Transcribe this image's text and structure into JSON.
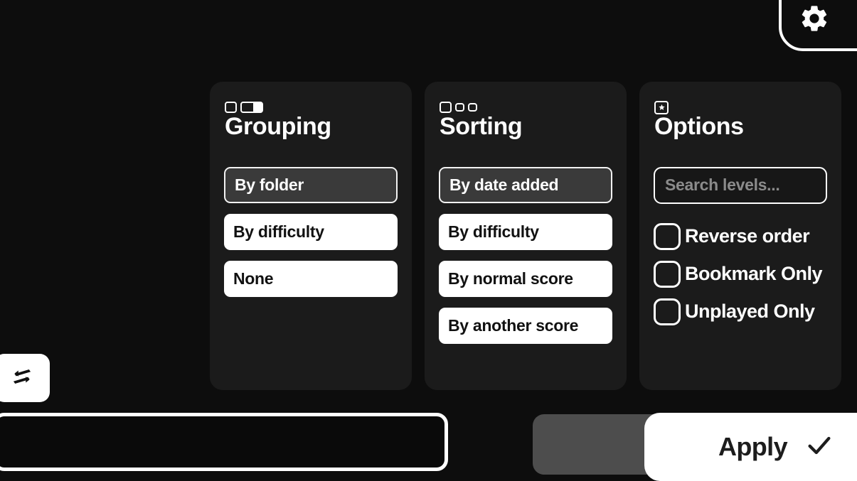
{
  "topbar": {
    "settings_icon": "gear-icon"
  },
  "cards": [
    {
      "key": "grouping",
      "title": "Grouping",
      "icon": "grouping-icon",
      "options": [
        {
          "label": "By folder",
          "selected": true
        },
        {
          "label": "By difficulty",
          "selected": false
        },
        {
          "label": "None",
          "selected": false
        }
      ]
    },
    {
      "key": "sorting",
      "title": "Sorting",
      "icon": "sorting-icon",
      "options": [
        {
          "label": "By date added",
          "selected": true
        },
        {
          "label": "By difficulty",
          "selected": false
        },
        {
          "label": "By normal score",
          "selected": false
        },
        {
          "label": "By another score",
          "selected": false
        }
      ]
    },
    {
      "key": "options",
      "title": "Options",
      "icon": "options-star-icon",
      "search": {
        "value": "",
        "placeholder": "Search levels..."
      },
      "checkboxes": [
        {
          "label": "Reverse order",
          "checked": false
        },
        {
          "label": "Bookmark Only",
          "checked": false
        },
        {
          "label": "Unplayed Only",
          "checked": false
        }
      ]
    }
  ],
  "footer": {
    "swap_icon": "swap-arrows-icon",
    "apply_label": "Apply",
    "apply_icon": "checkmark-icon"
  },
  "colors": {
    "page_background": "#0d0d0d",
    "card_background": "#1b1b1b",
    "accent_white": "#ffffff",
    "selected_fill": "#3a3a3a",
    "placeholder_gray": "#8b8b8b",
    "ghost_button": "#4d4d4d"
  }
}
